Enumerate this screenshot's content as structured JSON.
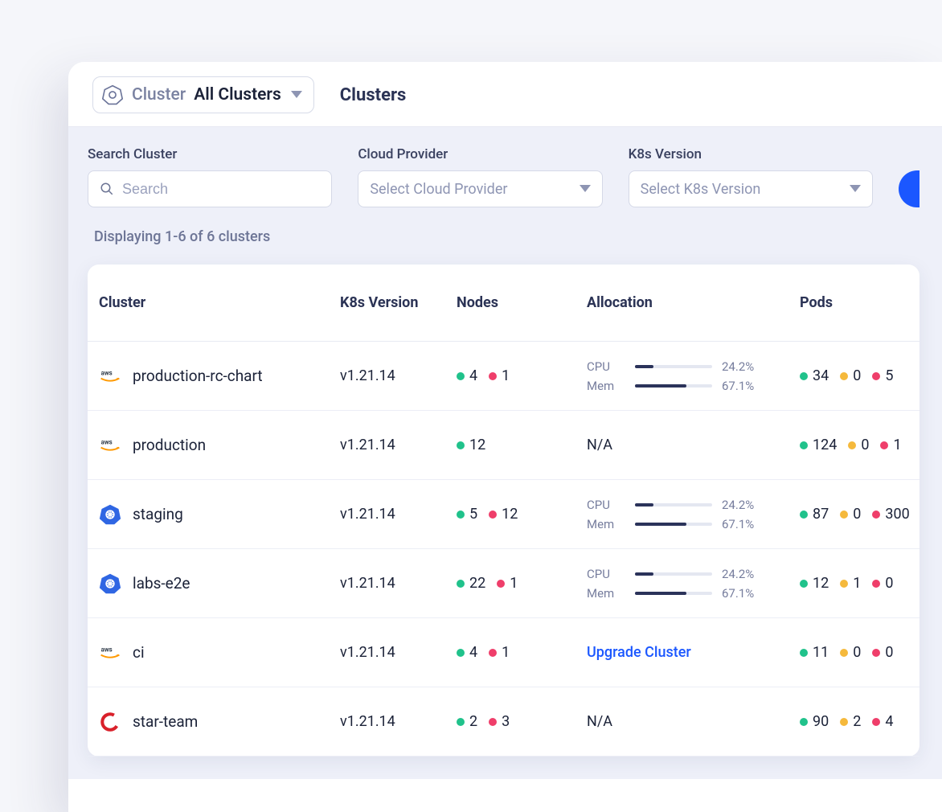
{
  "header": {
    "selector_label": "Cluster",
    "selector_value": "All Clusters",
    "page_title": "Clusters"
  },
  "filters": {
    "search": {
      "label": "Search Cluster",
      "placeholder": "Search"
    },
    "cloud": {
      "label": "Cloud Provider",
      "placeholder": "Select Cloud Provider"
    },
    "k8s": {
      "label": "K8s Version",
      "placeholder": "Select K8s Version"
    }
  },
  "results_summary": "Displaying 1-6 of 6 clusters",
  "columns": {
    "cluster": "Cluster",
    "k8s_version": "K8s Version",
    "nodes": "Nodes",
    "allocation": "Allocation",
    "pods": "Pods"
  },
  "alloc_labels": {
    "cpu": "CPU",
    "mem": "Mem"
  },
  "na": "N/A",
  "upgrade": "Upgrade Cluster",
  "rows": [
    {
      "provider": "aws",
      "name": "production-rc-chart",
      "k8s_version": "v1.21.14",
      "nodes": {
        "green": 4,
        "red": 1
      },
      "allocation": {
        "cpu": "24.2%",
        "cpu_w": 24.2,
        "mem": "67.1%",
        "mem_w": 67.1
      },
      "pods": {
        "green": 34,
        "yellow": 0,
        "red": 5
      }
    },
    {
      "provider": "aws",
      "name": "production",
      "k8s_version": "v1.21.14",
      "nodes": {
        "green": 12
      },
      "allocation": "na",
      "pods": {
        "green": 124,
        "yellow": 0,
        "red": 1
      }
    },
    {
      "provider": "k8s",
      "name": "staging",
      "k8s_version": "v1.21.14",
      "nodes": {
        "green": 5,
        "red": 12
      },
      "allocation": {
        "cpu": "24.2%",
        "cpu_w": 24.2,
        "mem": "67.1%",
        "mem_w": 67.1
      },
      "pods": {
        "green": 87,
        "yellow": 0,
        "red": 300
      }
    },
    {
      "provider": "k8s",
      "name": "labs-e2e",
      "k8s_version": "v1.21.14",
      "nodes": {
        "green": 22,
        "red": 1
      },
      "allocation": {
        "cpu": "24.2%",
        "cpu_w": 24.2,
        "mem": "67.1%",
        "mem_w": 67.1
      },
      "pods": {
        "green": 12,
        "yellow": 1,
        "red": 0
      }
    },
    {
      "provider": "aws",
      "name": "ci",
      "k8s_version": "v1.21.14",
      "nodes": {
        "green": 4,
        "red": 1
      },
      "allocation": "upgrade",
      "pods": {
        "green": 11,
        "yellow": 0,
        "red": 0
      }
    },
    {
      "provider": "openshift",
      "name": "star-team",
      "k8s_version": "v1.21.14",
      "nodes": {
        "green": 2,
        "red": 3
      },
      "allocation": "na",
      "pods": {
        "green": 90,
        "yellow": 2,
        "red": 4
      }
    }
  ]
}
